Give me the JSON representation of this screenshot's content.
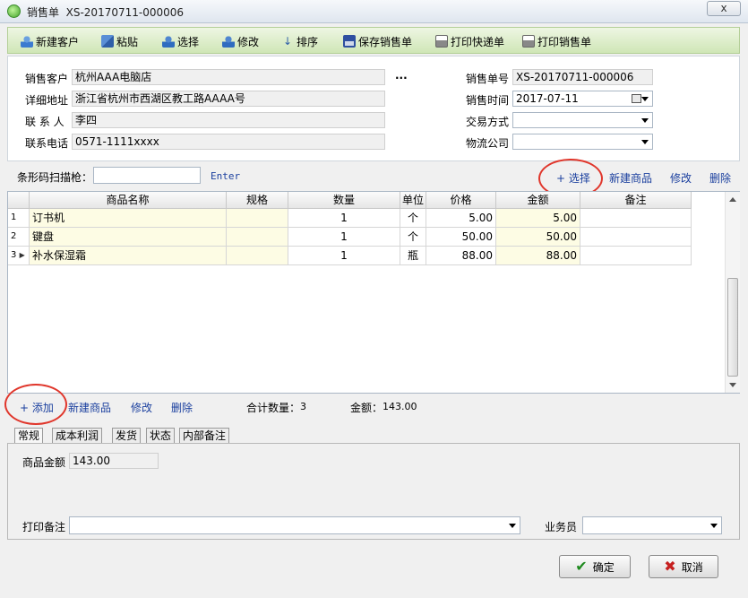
{
  "window": {
    "title": "销售单  XS-20170711-000006",
    "close_symbol": "x"
  },
  "toolbar": {
    "new_customer": "新建客户",
    "paste": "粘贴",
    "select": "选择",
    "edit": "修改",
    "sort": "排序",
    "save_order": "保存销售单",
    "print_express": "打印快递单",
    "print_order": "打印销售单"
  },
  "header": {
    "customer_label": "销售客户",
    "customer_value": "杭州AAA电脑店",
    "more_label": "...",
    "address_label": "详细地址",
    "address_value": "浙江省杭州市西湖区教工路AAAA号",
    "contact_label": "联 系 人",
    "contact_value": "李四",
    "phone_label": "联系电话",
    "phone_value": "0571-1111xxxx",
    "order_no_label": "销售单号",
    "order_no_value": "XS-20170711-000006",
    "time_label": "销售时间",
    "time_value": "2017-07-11",
    "payment_label": "交易方式",
    "payment_value": "",
    "logistics_label": "物流公司",
    "logistics_value": ""
  },
  "barcode": {
    "label": "条形码扫描枪：",
    "value": "",
    "enter_label": "Enter",
    "select_link": "+ 选择",
    "new_product_link": "新建商品",
    "edit_link": "修改",
    "delete_link": "删除"
  },
  "grid": {
    "columns": [
      "商品名称",
      "规格",
      "数量",
      "单位",
      "价格",
      "金额",
      "备注"
    ],
    "rows": [
      {
        "no": "1",
        "marker": "",
        "name": "订书机",
        "spec": "",
        "qty": "1",
        "unit": "个",
        "price": "5.00",
        "amount": "5.00",
        "note": ""
      },
      {
        "no": "2",
        "marker": "",
        "name": "键盘",
        "spec": "",
        "qty": "1",
        "unit": "个",
        "price": "50.00",
        "amount": "50.00",
        "note": ""
      },
      {
        "no": "3",
        "marker": "▶",
        "name": "补水保湿霜",
        "spec": "",
        "qty": "1",
        "unit": "瓶",
        "price": "88.00",
        "amount": "88.00",
        "note": ""
      }
    ]
  },
  "footer": {
    "add_link": "+ 添加",
    "new_product_link": "新建商品",
    "edit_link": "修改",
    "delete_link": "删除",
    "total_qty_label": "合计数量：",
    "total_qty_value": "3",
    "amount_label": "金额：",
    "amount_value": "143.00"
  },
  "tabs": [
    "常规",
    "成本利润",
    "发货",
    "状态",
    "内部备注"
  ],
  "general": {
    "goods_amount_label": "商品金额",
    "goods_amount_value": "143.00",
    "print_note_label": "打印备注",
    "print_note_value": "",
    "salesperson_label": "业务员",
    "salesperson_value": ""
  },
  "buttons": {
    "ok": "确定",
    "cancel": "取消"
  },
  "colors": {
    "toolbar_green": "#cfe6b6",
    "link_blue": "#1a3f9e",
    "annotation_red": "#e0362b",
    "cell_yellow": "#fdfce4"
  }
}
